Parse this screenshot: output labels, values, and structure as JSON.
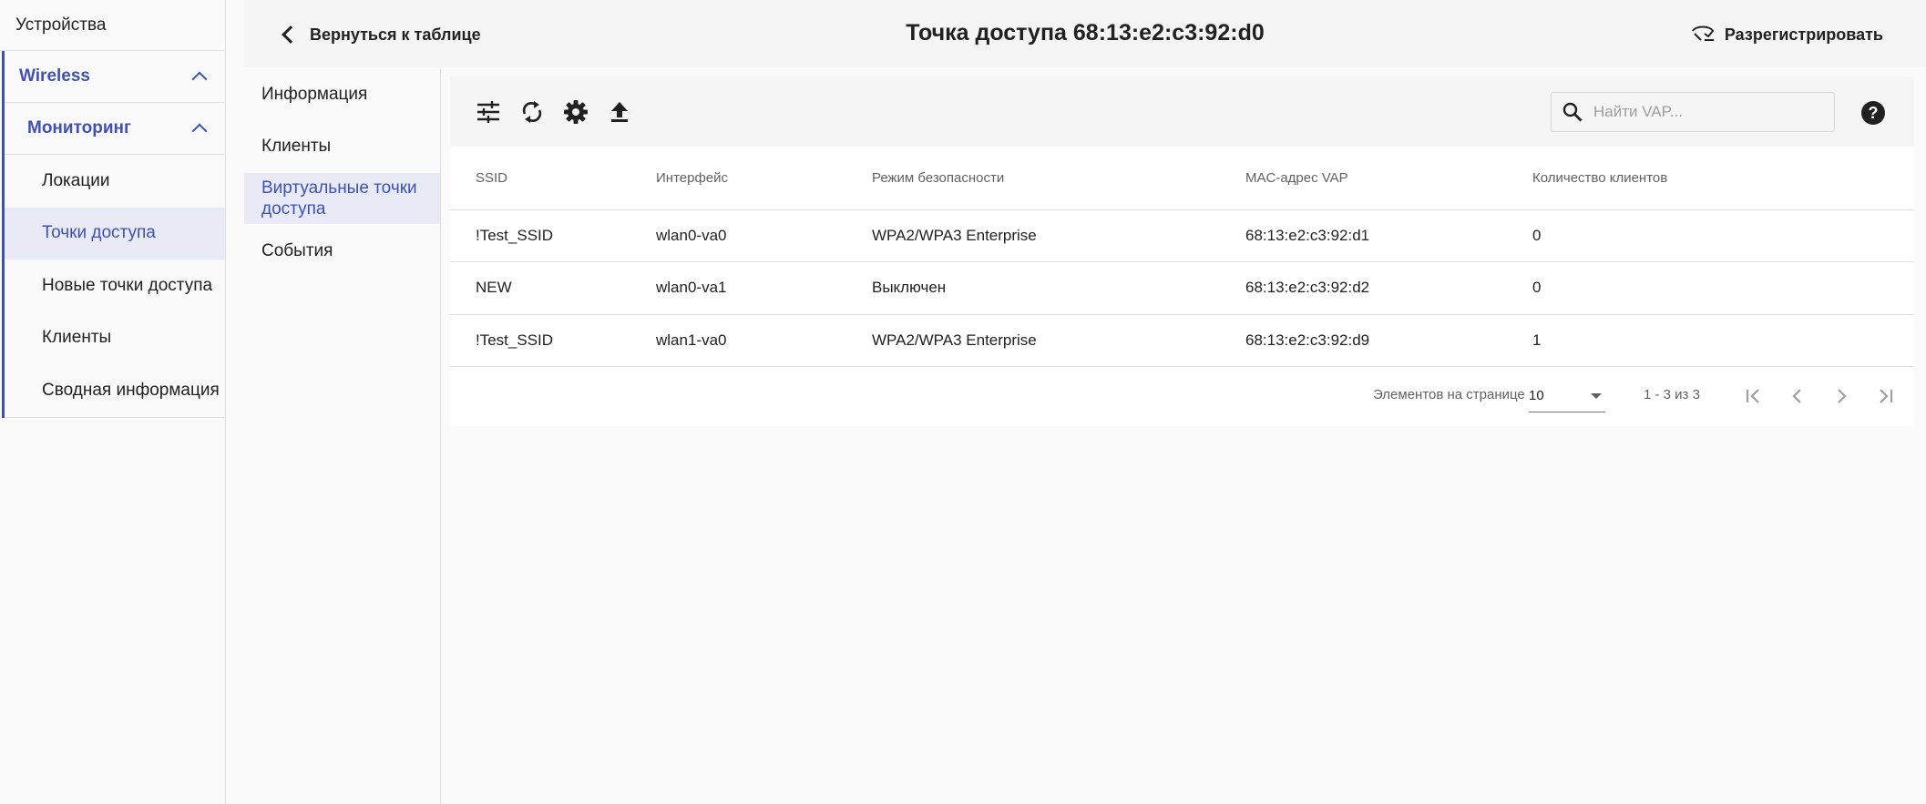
{
  "sidebar": {
    "devices_label": "Устройства",
    "wireless_label": "Wireless",
    "monitoring_label": "Мониторинг",
    "items": [
      {
        "label": "Локации"
      },
      {
        "label": "Точки доступа"
      },
      {
        "label": "Новые точки доступа"
      },
      {
        "label": "Клиенты"
      },
      {
        "label": "Сводная информация"
      }
    ]
  },
  "header": {
    "back_label": "Вернуться к таблице",
    "title": "Точка доступа 68:13:e2:c3:92:d0",
    "unregister_label": "Разрегистрировать"
  },
  "subnav": {
    "items": [
      {
        "label": "Информация"
      },
      {
        "label": "Клиенты"
      },
      {
        "label": "Виртуальные точки доступа"
      },
      {
        "label": "События"
      }
    ]
  },
  "toolbar": {
    "icons": [
      "tune-icon",
      "sync-icon",
      "settings-icon",
      "upload-icon"
    ],
    "search_placeholder": "Найти VAP...",
    "help_label": "?"
  },
  "table": {
    "columns": [
      "SSID",
      "Интерфейс",
      "Режим безопасности",
      "MAC-адрес VAP",
      "Количество клиентов"
    ],
    "rows": [
      [
        "!Test_SSID",
        "wlan0-va0",
        "WPA2/WPA3 Enterprise",
        "68:13:e2:c3:92:d1",
        "0"
      ],
      [
        "NEW",
        "wlan0-va1",
        "Выключен",
        "68:13:e2:c3:92:d2",
        "0"
      ],
      [
        "!Test_SSID",
        "wlan1-va0",
        "WPA2/WPA3 Enterprise",
        "68:13:e2:c3:92:d9",
        "1"
      ]
    ]
  },
  "paginator": {
    "items_per_page_label": "Элементов на странице",
    "page_size": "10",
    "range_label": "1 - 3 из 3"
  },
  "colors": {
    "accent": "#3f51b5",
    "active_bg": "#e8eaf6"
  }
}
